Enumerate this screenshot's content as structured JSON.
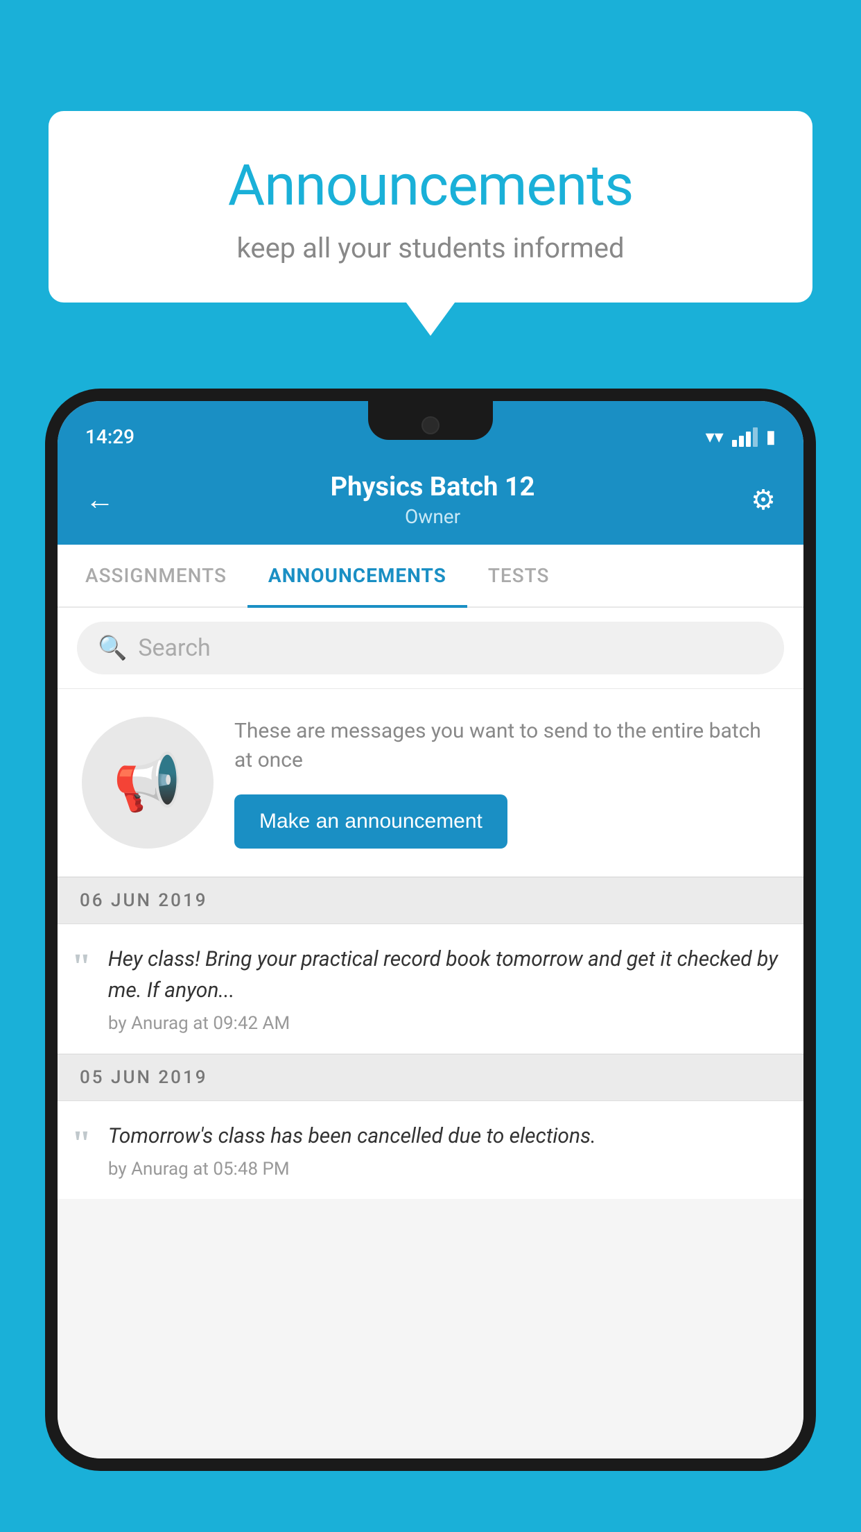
{
  "background_color": "#1ab0d8",
  "speech_bubble": {
    "title": "Announcements",
    "subtitle": "keep all your students informed"
  },
  "phone": {
    "status_bar": {
      "time": "14:29"
    },
    "header": {
      "title": "Physics Batch 12",
      "subtitle": "Owner",
      "back_label": "←",
      "gear_label": "⚙"
    },
    "tabs": [
      {
        "label": "ASSIGNMENTS",
        "active": false
      },
      {
        "label": "ANNOUNCEMENTS",
        "active": true
      },
      {
        "label": "TESTS",
        "active": false
      }
    ],
    "search": {
      "placeholder": "Search"
    },
    "promo": {
      "description": "These are messages you want to send to the entire batch at once",
      "button_label": "Make an announcement"
    },
    "announcements": [
      {
        "date": "06  JUN  2019",
        "text": "Hey class! Bring your practical record book tomorrow and get it checked by me. If anyon...",
        "meta": "by Anurag at 09:42 AM"
      },
      {
        "date": "05  JUN  2019",
        "text": "Tomorrow's class has been cancelled due to elections.",
        "meta": "by Anurag at 05:48 PM"
      }
    ]
  }
}
